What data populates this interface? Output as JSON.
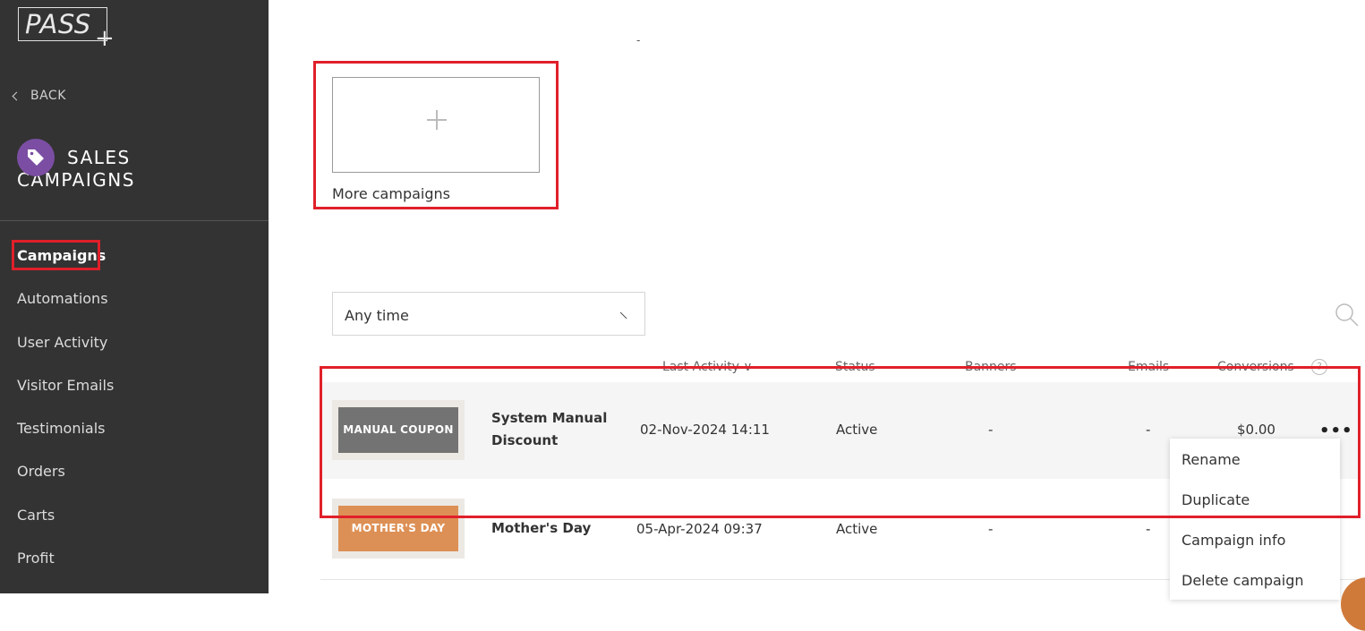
{
  "app": {
    "logo_text": "PASS",
    "logo_plus": "+"
  },
  "sidebar": {
    "back_label": "BACK",
    "section_title_line1": "SALES",
    "section_title_line2": "CAMPAIGNS",
    "section_icon": "tag-icon",
    "items": [
      {
        "label": "Campaigns",
        "active": true
      },
      {
        "label": "Automations"
      },
      {
        "label": "User Activity"
      },
      {
        "label": "Visitor Emails"
      },
      {
        "label": "Testimonials"
      },
      {
        "label": "Orders"
      },
      {
        "label": "Carts"
      },
      {
        "label": "Profit"
      }
    ]
  },
  "main": {
    "top_fragment": "-",
    "more_campaigns_label": "More campaigns",
    "time_filter": {
      "value": "Any time"
    },
    "columns": {
      "last_activity": "Last Activity ∨",
      "status": "Status",
      "banners": "Banners",
      "emails": "Emails",
      "conversions": "Conversions",
      "help": "?"
    },
    "rows": [
      {
        "thumb_text": "MANUAL COUPON",
        "name_line1": "System Manual",
        "name_line2": "Discount",
        "last_activity": "02-Nov-2024  14:11",
        "status": "Active",
        "banners": "-",
        "emails": "-",
        "conversions": "$0.00"
      },
      {
        "thumb_text": "MOTHER'S DAY",
        "name_line1": "Mother's Day",
        "last_activity": "05-Apr-2024  09:37",
        "status": "Active",
        "banners": "-",
        "emails": "-"
      }
    ],
    "more_menu_dots": "•••",
    "context_menu": [
      "Rename",
      "Duplicate",
      "Campaign info",
      "Delete campaign"
    ]
  },
  "colors": {
    "sidebar_bg": "#333333",
    "highlight": "#e0202a",
    "tag_icon_bg": "#7b4ea3",
    "thumb_manual": "#737373",
    "thumb_mothers_day": "#dd9055"
  }
}
